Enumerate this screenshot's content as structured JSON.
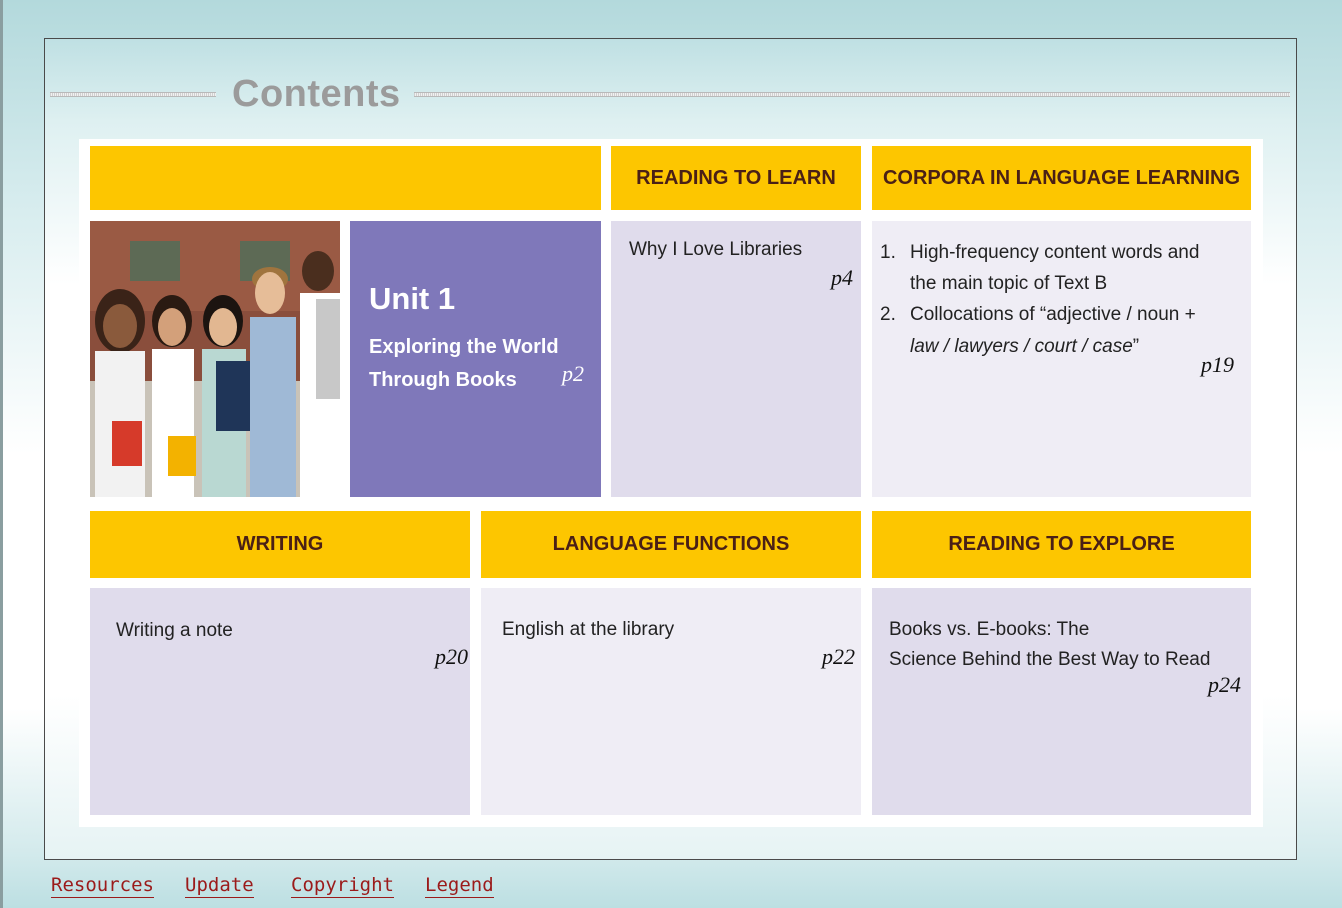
{
  "page": {
    "title": "Contents"
  },
  "unit": {
    "title": "Unit 1",
    "subtitle_line1": "Exploring the World",
    "subtitle_line2": "Through Books",
    "page": "p2",
    "photo_icon": "students-photo"
  },
  "sections": {
    "reading_to_learn": {
      "header": "READING TO LEARN",
      "item": "Why I Love Libraries",
      "page": "p4"
    },
    "corpora": {
      "header": "CORPORA IN LANGUAGE LEARNING",
      "items": [
        {
          "num": "1.",
          "line1": "High-frequency content words and",
          "line2": "the main topic of Text B"
        },
        {
          "num": "2.",
          "line1": "Collocations of “adjective / noun +",
          "line2_italic": "law / lawyers / court / case",
          "line2_end": "”"
        }
      ],
      "page": "p19"
    },
    "writing": {
      "header": "WRITING",
      "item": "Writing a note",
      "page": "p20"
    },
    "language_functions": {
      "header": "LANGUAGE FUNCTIONS",
      "item": "English at the library",
      "page": "p22"
    },
    "reading_to_explore": {
      "header": "READING TO EXPLORE",
      "item_line1": "Books vs. E-books: The",
      "item_line2": "Science Behind the Best Way to Read",
      "page": "p24"
    }
  },
  "footer": {
    "links": [
      "Resources",
      "Update",
      "Copyright",
      "Legend"
    ]
  },
  "colors": {
    "header_yellow": "#fdc600",
    "header_text": "#4a2016",
    "unit_purple": "#7f78ba",
    "cell_lavender": "#e0dcec",
    "cell_light": "#efedf5",
    "title_gray": "#9b9b9b",
    "link_red": "#9b1a1a"
  }
}
